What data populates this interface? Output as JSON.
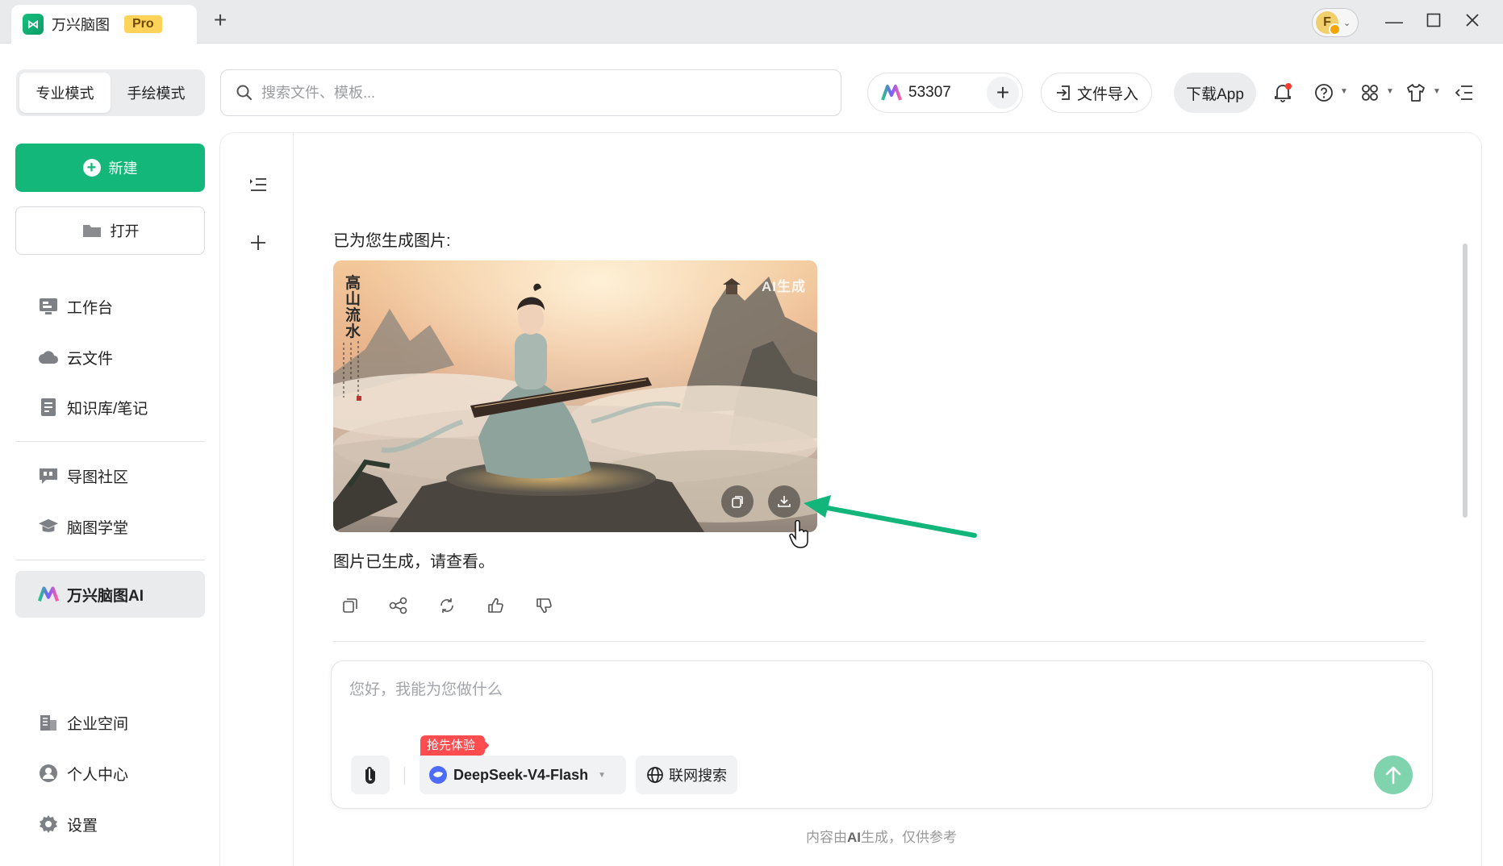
{
  "titlebar": {
    "app_name": "万兴脑图",
    "badge": "Pro",
    "avatar_letter": "F"
  },
  "toolbar": {
    "modes": [
      "专业模式",
      "手绘模式"
    ],
    "active_mode": "专业模式",
    "search_placeholder": "搜索文件、模板...",
    "points": "53307",
    "import_label": "文件导入",
    "download_app_label": "下载App"
  },
  "sidebar": {
    "new_label": "新建",
    "open_label": "打开",
    "items": [
      {
        "label": "工作台",
        "icon": "workbench-icon"
      },
      {
        "label": "云文件",
        "icon": "cloud-icon"
      },
      {
        "label": "知识库/笔记",
        "icon": "notebook-icon"
      },
      {
        "label": "导图社区",
        "icon": "community-icon"
      },
      {
        "label": "脑图学堂",
        "icon": "graduation-cap-icon"
      },
      {
        "label": "万兴脑图AI",
        "icon": "ai-logo-icon"
      },
      {
        "label": "企业空间",
        "icon": "enterprise-icon"
      },
      {
        "label": "个人中心",
        "icon": "user-icon"
      },
      {
        "label": "设置",
        "icon": "gear-icon"
      }
    ],
    "active_item": "万兴脑图AI"
  },
  "chat": {
    "generated_intro": "已为您生成图片:",
    "image_watermark": "AI生成",
    "image_caption_vertical": "高山流水",
    "done_text": "图片已生成，请查看。",
    "actions": [
      "copy-icon",
      "share-icon",
      "regenerate-icon",
      "thumbs-up-icon",
      "thumbs-down-icon"
    ]
  },
  "composer": {
    "placeholder": "您好，我能为您做什么",
    "promo_badge": "抢先体验",
    "model_name": "DeepSeek-V4-Flash",
    "web_search_label": "联网搜索",
    "disclaimer_prefix": "内容由",
    "disclaimer_bold": "AI",
    "disclaimer_suffix": "生成，仅供参考"
  },
  "colors": {
    "brand_green": "#13b77a",
    "send_button": "#7fd3ad",
    "promo_red": "#ff4d4f",
    "annotation_arrow": "#12b57a"
  }
}
